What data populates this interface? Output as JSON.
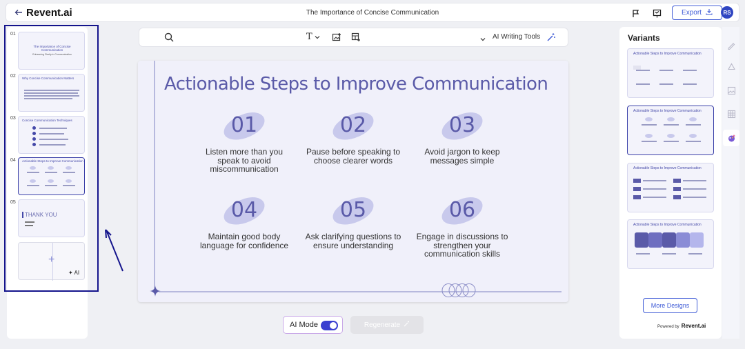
{
  "app": {
    "brand": "Revent.ai",
    "doc_title": "The Importance of Concise Communication"
  },
  "topbar": {
    "export_label": "Export",
    "avatar_initials": "RS"
  },
  "toolbar": {
    "ai_tools_label": "AI Writing Tools"
  },
  "thumbnails": [
    {
      "num": "01",
      "title": "The Importance of Concise Communication",
      "subtitle": "Enhancing Clarity in Communication"
    },
    {
      "num": "02",
      "title": "Why Concise Communication Matters"
    },
    {
      "num": "03",
      "title": "Concise Communication Techniques"
    },
    {
      "num": "04",
      "title": "Actionable Steps to Improve Communication"
    },
    {
      "num": "05",
      "title": "THANK YOU"
    }
  ],
  "add_slide": {
    "ai_label": "AI"
  },
  "slide": {
    "title": "Actionable Steps to Improve Communication",
    "steps": [
      {
        "num": "01",
        "text": "Listen more than you speak to avoid miscommunication"
      },
      {
        "num": "02",
        "text": "Pause before speaking to choose clearer words"
      },
      {
        "num": "03",
        "text": "Avoid jargon to keep messages simple"
      },
      {
        "num": "04",
        "text": "Maintain good body language for confidence"
      },
      {
        "num": "05",
        "text": "Ask clarifying questions to ensure understanding"
      },
      {
        "num": "06",
        "text": "Engage in discussions to strengthen your communication skills"
      }
    ]
  },
  "bottom": {
    "ai_mode_label": "AI Mode",
    "regenerate_label": "Regenerate"
  },
  "variants": {
    "title": "Variants",
    "items": [
      {
        "title": "Actionable Steps to Improve Communication"
      },
      {
        "title": "Actionable Steps to Improve Communication"
      },
      {
        "title": "Actionable Steps to Improve Communication"
      },
      {
        "title": "Actionable Steps to Improve Communication"
      }
    ],
    "more_label": "More Designs",
    "powered_label": "Powered by",
    "powered_brand": "Revent.ai"
  },
  "colors": {
    "accent": "#3f5bd6",
    "slide_text": "#5a5aa8",
    "selection": "#14148c"
  },
  "icons": [
    "back-arrow-icon",
    "flag-icon",
    "present-icon",
    "download-icon",
    "search-icon",
    "text-icon",
    "image-add-icon",
    "layout-icon",
    "chevron-down-icon",
    "magic-wand-icon",
    "sparkle-icon"
  ]
}
